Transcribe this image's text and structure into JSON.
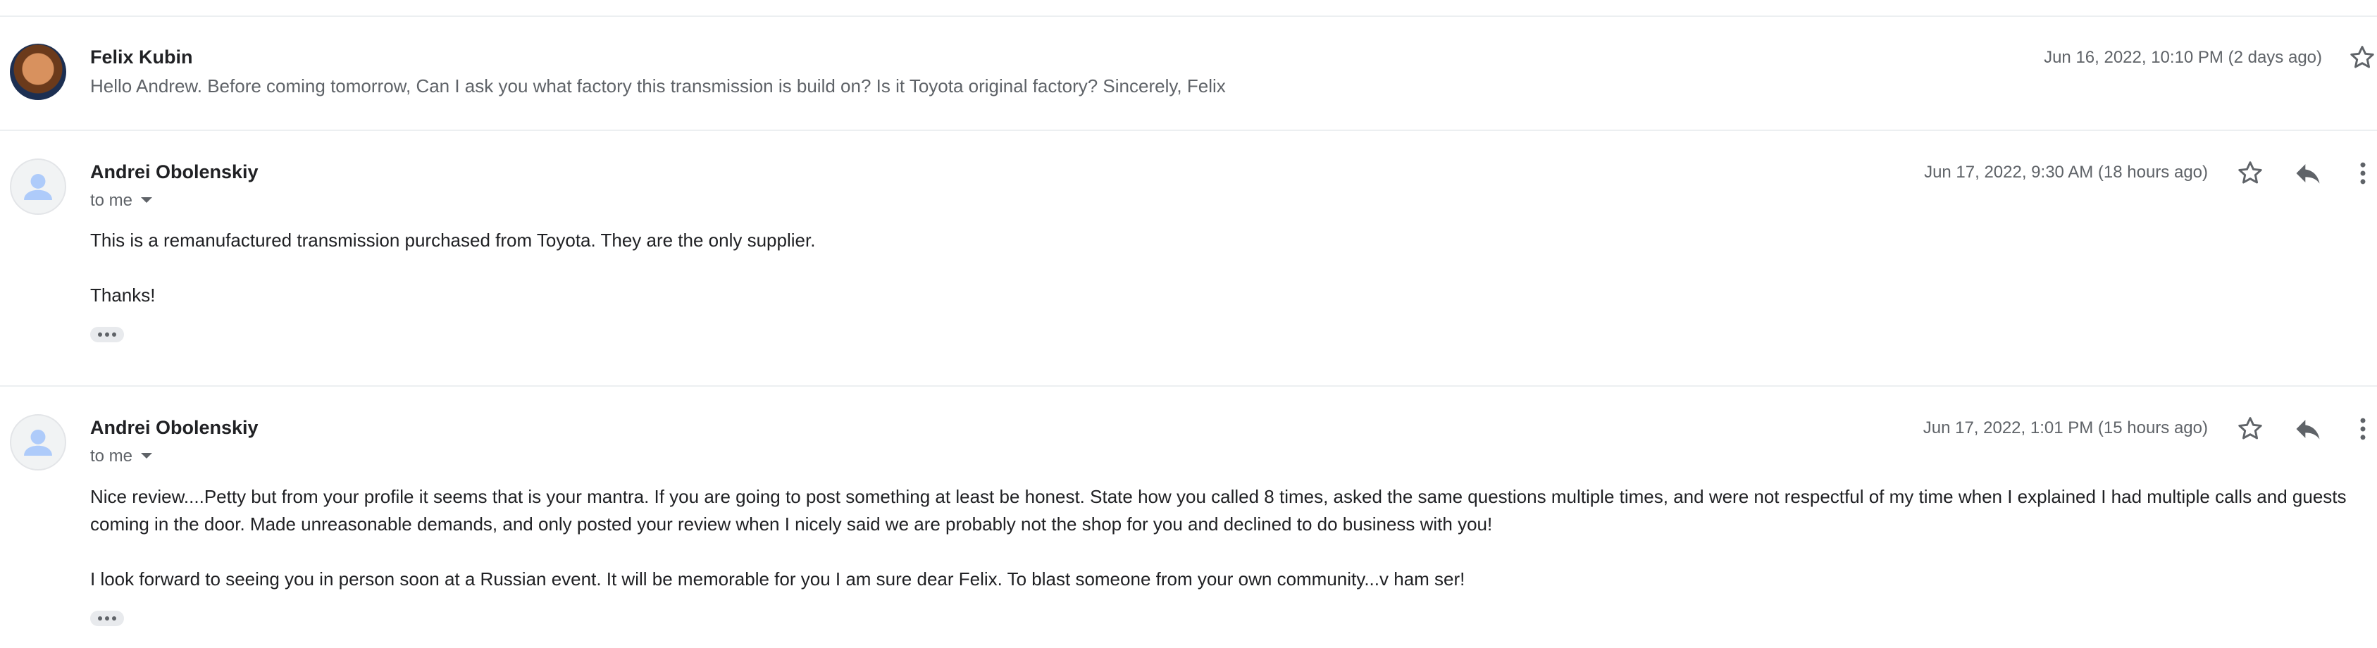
{
  "messages": [
    {
      "sender": "Felix Kubin",
      "snippet": "Hello Andrew. Before coming tomorrow, Can I ask you what factory this transmission is build on? Is it Toyota original factory? Sincerely, Felix",
      "date": "Jun 16, 2022, 10:10 PM (2 days ago)",
      "avatar": "photo-avatar"
    },
    {
      "sender": "Andrei Obolenskiy",
      "recipient": "to me",
      "date": "Jun 17, 2022, 9:30 AM (18 hours ago)",
      "paragraphs": [
        "This is a remanufactured transmission purchased from Toyota. They are the only supplier.",
        "Thanks!"
      ],
      "avatar": "default-person-icon"
    },
    {
      "sender": "Andrei Obolenskiy",
      "recipient": "to me",
      "date": "Jun 17, 2022, 1:01 PM (15 hours ago)",
      "paragraphs": [
        "Nice review....Petty but from your profile it seems that is your mantra. If you are going to post something at least be honest. State how you called 8 times, asked the same questions multiple times, and were not respectful of my time when I explained I had multiple calls and guests coming in the door. Made unreasonable demands, and only posted your review when I nicely said we are probably not the shop for you and declined to do business with you!",
        "I look forward to seeing you in person soon at a Russian event. It will be memorable for you I am sure dear Felix. To blast someone from your own community...v ham ser!"
      ],
      "avatar": "default-person-icon"
    }
  ],
  "icons": [
    "star-icon",
    "reply-icon",
    "more-vert-icon",
    "show-trimmed-content-icon"
  ],
  "colors": {
    "icon": "#5f6368",
    "avatar_glyph": "#aecbfa",
    "divider": "#eceff1"
  }
}
